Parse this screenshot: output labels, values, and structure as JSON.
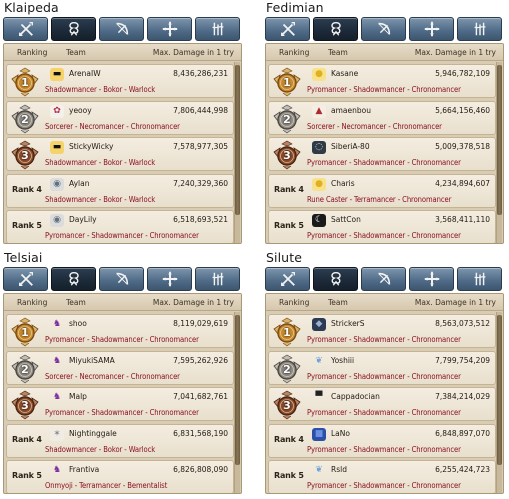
{
  "header": {
    "ranking": "Ranking",
    "team": "Team",
    "max_damage": "Max. Damage in 1 try"
  },
  "tab_icons": [
    "swords-icon",
    "summoner-icon",
    "bow-icon",
    "cross-icon",
    "cleric-icon"
  ],
  "servers": [
    {
      "name": "Klaipeda",
      "active_tab": 1,
      "rows": [
        {
          "rank": "1",
          "name": "ArenaIW",
          "damage": "8,436,286,231",
          "classes": "Shadowmancer - Bokor - Warlock",
          "avatar": "sunglasses-avatar-icon"
        },
        {
          "rank": "2",
          "name": "yeooy",
          "damage": "7,806,444,998",
          "classes": "Sorcerer - Necromancer - Chronomancer",
          "avatar": "character-avatar-icon"
        },
        {
          "rank": "3",
          "name": "StickyWicky",
          "damage": "7,578,977,305",
          "classes": "Shadowmancer - Bokor - Warlock",
          "avatar": "sunglasses-avatar-icon"
        },
        {
          "rank": "Rank 4",
          "name": "Aylan",
          "damage": "7,240,329,360",
          "classes": "Shadowmancer - Bokor - Warlock",
          "avatar": "round-avatar-icon"
        },
        {
          "rank": "Rank 5",
          "name": "DayLily",
          "damage": "6,518,693,521",
          "classes": "Pyromancer - Shadowmancer - Chronomancer",
          "avatar": "round-avatar-icon"
        }
      ]
    },
    {
      "name": "Fedimian",
      "active_tab": 1,
      "rows": [
        {
          "rank": "1",
          "name": "Kasane",
          "damage": "5,946,782,109",
          "classes": "Pyromancer - Shadowmancer - Chronomancer",
          "avatar": "chick-avatar-icon"
        },
        {
          "rank": "2",
          "name": "amaenbou",
          "damage": "5,664,156,460",
          "classes": "Sorcerer - Necromancer - Chronomancer",
          "avatar": "mushroom-avatar-icon"
        },
        {
          "rank": "3",
          "name": "SiberiA-80",
          "damage": "5,009,378,518",
          "classes": "Pyromancer - Shadowmancer - Chronomancer",
          "avatar": "bubble-avatar-icon"
        },
        {
          "rank": "Rank 4",
          "name": "Charis",
          "damage": "4,234,894,607",
          "classes": "Rune Caster - Terramancer - Chronomancer",
          "avatar": "chick-avatar-icon"
        },
        {
          "rank": "Rank 5",
          "name": "SattCon",
          "damage": "3,568,411,110",
          "classes": "Pyromancer - Shadowmancer - Chronomancer",
          "avatar": "moon-avatar-icon"
        }
      ]
    },
    {
      "name": "Telsiai",
      "active_tab": 1,
      "rows": [
        {
          "rank": "1",
          "name": "shoo",
          "damage": "8,119,029,619",
          "classes": "Pyromancer - Shadowmancer - Chronomancer",
          "avatar": "purple-figure-avatar-icon"
        },
        {
          "rank": "2",
          "name": "MiyukiSAMA",
          "damage": "7,595,262,926",
          "classes": "Sorcerer - Necromancer - Chronomancer",
          "avatar": "purple-figure-avatar-icon"
        },
        {
          "rank": "3",
          "name": "Malp",
          "damage": "7,041,682,761",
          "classes": "Pyromancer - Shadowmancer - Chronomancer",
          "avatar": "purple-figure-avatar-icon"
        },
        {
          "rank": "Rank 4",
          "name": "Nightinggale",
          "damage": "6,831,568,190",
          "classes": "Shadowmancer - Bokor - Warlock",
          "avatar": "sparkle-avatar-icon"
        },
        {
          "rank": "Rank 5",
          "name": "Frantiva",
          "damage": "6,826,808,090",
          "classes": "Onmyoji - Terramancer - Bementalist",
          "avatar": "purple-figure-avatar-icon"
        }
      ]
    },
    {
      "name": "Silute",
      "active_tab": 1,
      "rows": [
        {
          "rank": "1",
          "name": "StrickerS",
          "damage": "8,563,073,512",
          "classes": "Pyromancer - Shadowmancer - Chronomancer",
          "avatar": "shield-avatar-icon"
        },
        {
          "rank": "2",
          "name": "Yoshiii",
          "damage": "7,799,754,209",
          "classes": "Pyromancer - Shadowmancer - Chronomancer",
          "avatar": "wing-avatar-icon"
        },
        {
          "rank": "3",
          "name": "Cappadocian",
          "damage": "7,384,214,029",
          "classes": "Pyromancer - Shadowmancer - Chronomancer",
          "avatar": "hat-avatar-icon"
        },
        {
          "rank": "Rank 4",
          "name": "LaNo",
          "damage": "6,848,897,070",
          "classes": "Pyromancer - Shadowmancer - Chronomancer",
          "avatar": "blue-square-avatar-icon"
        },
        {
          "rank": "Rank 5",
          "name": "Rsld",
          "damage": "6,255,424,723",
          "classes": "Pyromancer - Shadowmancer - Chronomancer",
          "avatar": "wing-avatar-icon"
        }
      ]
    }
  ]
}
